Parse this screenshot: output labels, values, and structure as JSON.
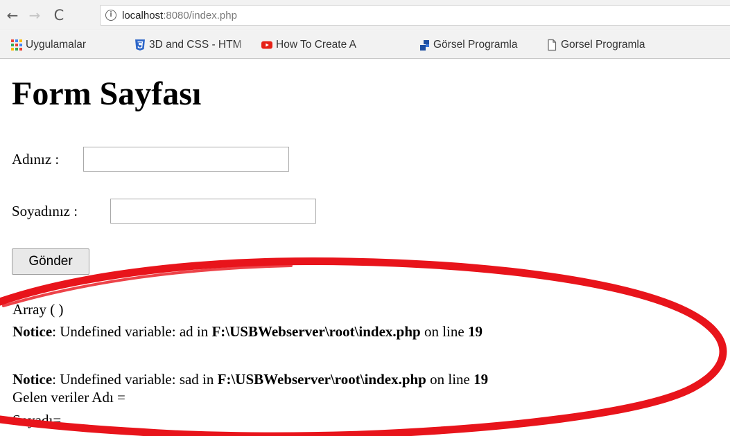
{
  "browser": {
    "url_host": "localhost",
    "url_path": ":8080/index.php",
    "info_glyph": "i",
    "nav_icons": {
      "back": "←",
      "forward": "→",
      "reload": "C"
    },
    "bookmarks": [
      {
        "label": "Uygulamalar",
        "icon": "apps-grid-icon"
      },
      {
        "label": "3D and CSS - HTM",
        "icon": "html5-icon"
      },
      {
        "label": "How To Create A",
        "icon": "youtube-icon"
      },
      {
        "label": "Görsel Programla",
        "icon": "bookmark-flag-icon"
      },
      {
        "label": "Gorsel Programla",
        "icon": "page-icon"
      }
    ]
  },
  "page": {
    "title": "Form Sayfası",
    "fields": [
      {
        "label": "Adınız :",
        "value": ""
      },
      {
        "label": "Soyadınız :",
        "value": ""
      }
    ],
    "submit_label": "Gönder",
    "output": {
      "array_line": "Array ( )",
      "notices": [
        {
          "label": "Notice",
          "msg": ": Undefined variable: ad in ",
          "file": "F:\\USBWebserver\\root\\index.php",
          "on_line": " on line ",
          "line": "19"
        },
        {
          "label": "Notice",
          "msg": ": Undefined variable: sad in ",
          "file": "F:\\USBWebserver\\root\\index.php",
          "on_line": " on line ",
          "line": "19"
        }
      ],
      "gelen_line": "Gelen veriler Adı =",
      "soyadi_line": "Soyadı="
    }
  },
  "colors": {
    "annotation_red": "#e8141b",
    "chrome_bg": "#f2f2f2"
  }
}
